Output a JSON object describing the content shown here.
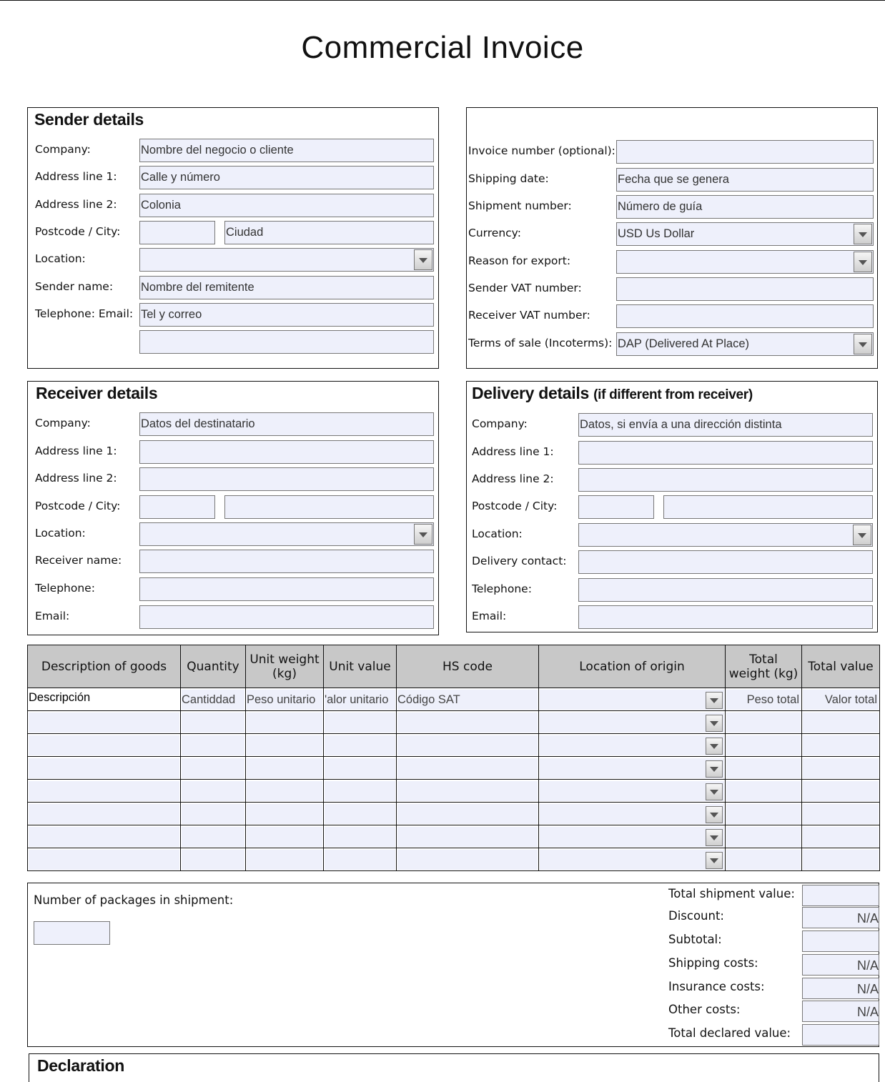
{
  "title": "Commercial Invoice",
  "sender": {
    "heading": "Sender details",
    "rows": [
      {
        "label": "Company:",
        "value": "Nombre del negocio o cliente"
      },
      {
        "label": "Address line 1:",
        "value": "Calle y número"
      },
      {
        "label": "Address line 2:",
        "value": "Colonia"
      },
      {
        "label": "Postcode / City:",
        "postcode": "",
        "city": "Ciudad"
      },
      {
        "label": "Location:",
        "value": ""
      },
      {
        "label": "Sender name:",
        "value": "Nombre del remitente"
      },
      {
        "label": "Telephone: Email:",
        "value": "Tel y correo",
        "value2": ""
      }
    ]
  },
  "invoice": {
    "rows": [
      {
        "label": "Invoice number (optional):",
        "value": ""
      },
      {
        "label": "Shipping date:",
        "value": "Fecha que se genera"
      },
      {
        "label": "Shipment number:",
        "value": "Número de guía"
      },
      {
        "label": "Currency:",
        "value": "USD Us Dollar"
      },
      {
        "label": "Reason for export:",
        "value": ""
      },
      {
        "label": "Sender VAT number:",
        "value": ""
      },
      {
        "label": "Receiver VAT number:",
        "value": ""
      },
      {
        "label": "Terms of sale (Incoterms):",
        "value": "DAP (Delivered At Place)"
      }
    ]
  },
  "receiver": {
    "heading": "Receiver details",
    "rows": [
      {
        "label": "Company:",
        "value": "Datos del destinatario"
      },
      {
        "label": "Address line 1:",
        "value": ""
      },
      {
        "label": "Address line 2:",
        "value": ""
      },
      {
        "label": "Postcode / City:",
        "postcode": "",
        "city": ""
      },
      {
        "label": "Location:",
        "value": ""
      },
      {
        "label": "Receiver name:",
        "value": ""
      },
      {
        "label": "Telephone:",
        "value": ""
      },
      {
        "label": "Email:",
        "value": ""
      }
    ]
  },
  "delivery": {
    "heading": "Delivery details",
    "heading_sub": "(if different from receiver)",
    "rows": [
      {
        "label": "Company:",
        "value": "Datos, si envía a una dirección distinta"
      },
      {
        "label": "Address line 1:",
        "value": ""
      },
      {
        "label": "Address line 2:",
        "value": ""
      },
      {
        "label": "Postcode / City:",
        "postcode": "",
        "city": ""
      },
      {
        "label": "Location:",
        "value": ""
      },
      {
        "label": "Delivery contact:",
        "value": ""
      },
      {
        "label": "Telephone:",
        "value": ""
      },
      {
        "label": "Email:",
        "value": ""
      }
    ]
  },
  "goods": {
    "headers": [
      "Description of goods",
      "Quantity",
      "Unit weight (kg)",
      "Unit value",
      "HS  code",
      "Location of origin",
      "Total weight (kg)",
      "Total value"
    ],
    "first_row": [
      "Descripción",
      "Cantiddad",
      "Peso unitario",
      "'alor unitario",
      "Código SAT",
      "",
      "Peso total",
      "Valor total"
    ],
    "empty_rows": 7
  },
  "packages": {
    "label": "Number of packages in shipment:",
    "value": ""
  },
  "totals": [
    {
      "label": "Total shipment value:",
      "value": ""
    },
    {
      "label": "Discount:",
      "value": "N/A"
    },
    {
      "label": "Subtotal:",
      "value": ""
    },
    {
      "label": "Shipping costs:",
      "value": "N/A"
    },
    {
      "label": "Insurance costs:",
      "value": "N/A"
    },
    {
      "label": "Other costs:",
      "value": "N/A"
    },
    {
      "label": "Total declared value:",
      "value": ""
    }
  ],
  "declaration": {
    "heading": "Declaration"
  }
}
